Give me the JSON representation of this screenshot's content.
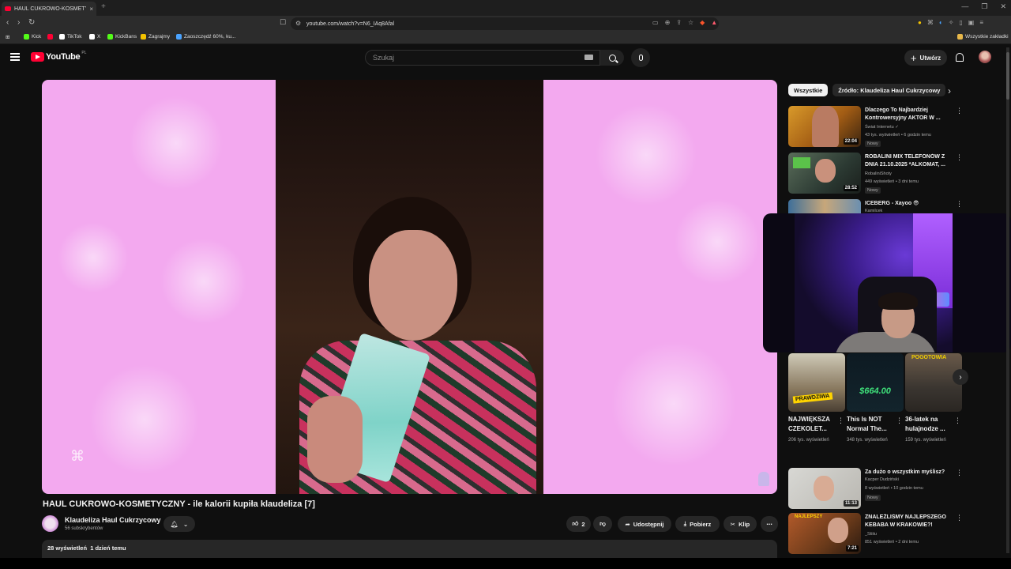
{
  "browser": {
    "tab_title": "HAUL CUKROWO-KOSMETYCZNY",
    "tab_close": "×",
    "new_tab": "+",
    "url": "youtube.com/watch?v=N6_IAq8Afal",
    "window_controls": [
      "—",
      "❐",
      "✕"
    ],
    "nav": {
      "back": "‹",
      "forward": "›",
      "reload": "↻"
    },
    "bookmarks": [
      {
        "label": "Kick",
        "color": "#53fc18"
      },
      {
        "label": "",
        "color": "#ff0033"
      },
      {
        "label": "TikTok",
        "color": "#ffffff"
      },
      {
        "label": "X",
        "color": "#ffffff"
      },
      {
        "label": "KickBans",
        "color": "#53fc18"
      },
      {
        "label": "Zagrajmy",
        "color": "#f2c200"
      },
      {
        "label": "Zaoszczędź 60%, ku...",
        "color": "#4aa3ff"
      }
    ],
    "bookmarks_folder": "Wszystkie zakładki"
  },
  "header": {
    "logo_text": "YouTube",
    "country_code": "PL",
    "search_placeholder": "Szukaj",
    "create_label": "Utwórz"
  },
  "video": {
    "title": "HAUL CUKROWO-KOSMETYCZNY - ile kalorii kupiła klaudeliza [7]",
    "channel_name": "Klaudeliza Haul Cukrzycowy",
    "subscribers": "56 subskrybentów",
    "likes": "2",
    "share_label": "Udostępnij",
    "download_label": "Pobierz",
    "clip_label": "Klip",
    "more_label": "⋯",
    "views": "28 wyświetleń",
    "uploaded": "1 dzień temu"
  },
  "sidebar": {
    "chips": [
      "Wszystkie",
      "Źródło: Klaudeliza Haul Cukrzycowy"
    ],
    "recommendations_top": [
      {
        "title": "Dlaczego To Najbardziej Kontrowersyjny AKTOR W ...",
        "channel": "Świat Internetu",
        "meta": "43 tys. wyświetleń • 6 godzin temu",
        "badge": "Nowy",
        "duration": "22:04"
      },
      {
        "title": "ROBALINI MIX TELEFONÓW Z DNIA 21.10.2025 *ALKOMAT, ...",
        "channel": "RobaliniShoty",
        "meta": "449 wyświetleń • 3 dni temu",
        "badge": "Nowy",
        "duration": "28:52"
      },
      {
        "title": "ICEBERG - Xayoo 😎",
        "channel": "Kamilcek",
        "meta": "",
        "badge": "",
        "duration": ""
      }
    ],
    "shorts": [
      {
        "title": "NAJWIĘKSZA CZEKOLET...",
        "views": "206 tys. wyświetleń",
        "overlay": "PRAWDZIWA"
      },
      {
        "title": "This Is NOT Normal The...",
        "views": "348 tys. wyświetleń",
        "overlay": "$664.00"
      },
      {
        "title": "36-latek na hulajnodze ...",
        "views": "159 tys. wyświetleń",
        "overlay": "POGOTOWIA"
      }
    ],
    "recommendations_bottom": [
      {
        "title": "Za dużo o wszystkim myślisz?",
        "channel": "Kacper Dudziński",
        "meta": "8 wyświetleń • 10 godzin temu",
        "badge": "Nowy",
        "duration": "11:13"
      },
      {
        "title": "ZNALEŹLIŚMY NAJLEPSZEGO KEBABA W KRAKOWIE?!",
        "channel": "_Stiiiu",
        "meta": "851 wyświetleń • 2 dni temu",
        "badge": "",
        "duration": "7:21"
      }
    ]
  }
}
